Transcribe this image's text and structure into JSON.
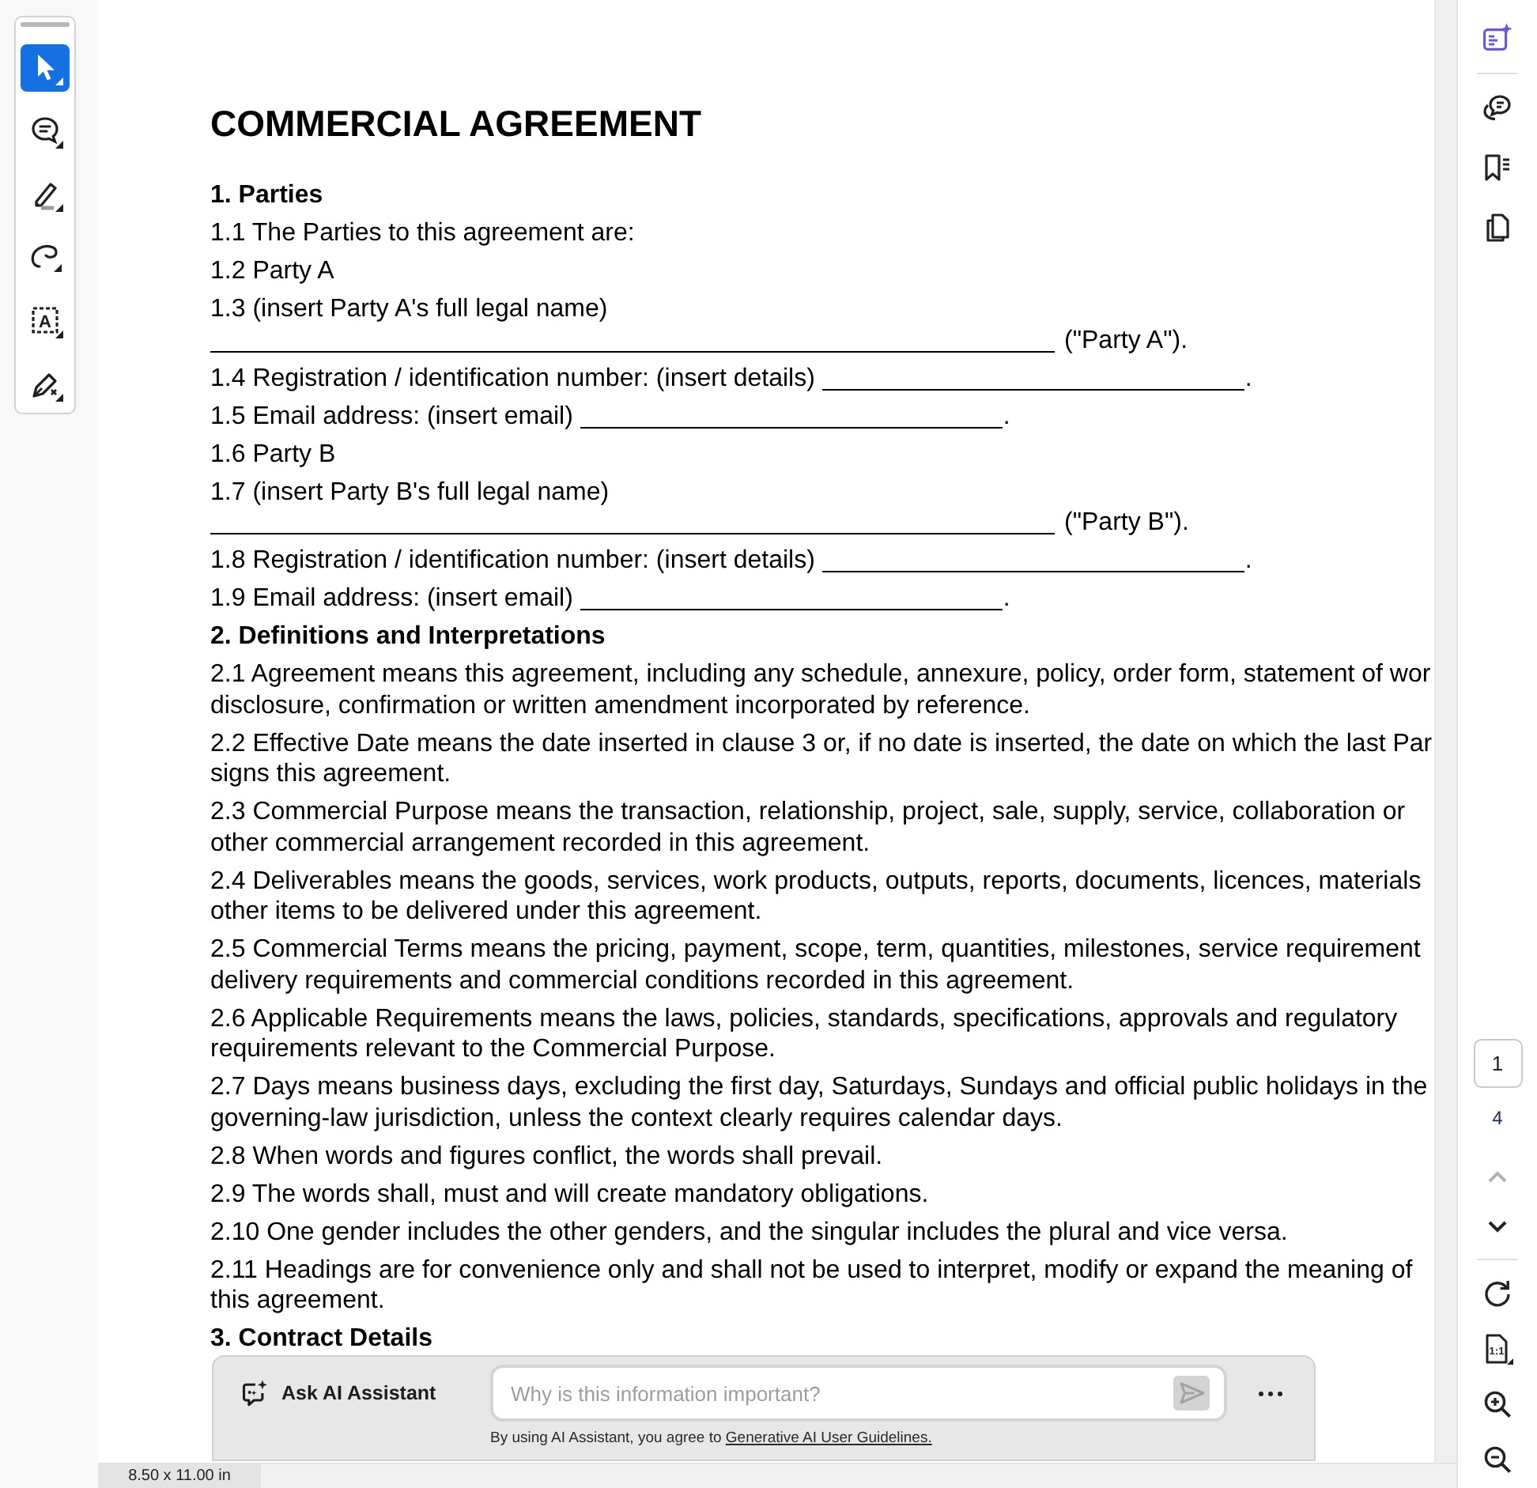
{
  "left_toolbar": {
    "tools": [
      {
        "kind": "select",
        "selected": true
      },
      {
        "kind": "comment",
        "selected": false
      },
      {
        "kind": "highlight",
        "selected": false
      },
      {
        "kind": "draw",
        "selected": false
      },
      {
        "kind": "text_select",
        "selected": false,
        "glyph": "A"
      },
      {
        "kind": "sign",
        "selected": false
      }
    ]
  },
  "document": {
    "title": "COMMERCIAL AGREEMENT",
    "sections": [
      {
        "heading": "1. Parties",
        "items": [
          {
            "kind": "paragraph",
            "lines": [
              "1.1 The Parties to this agreement are:"
            ]
          },
          {
            "kind": "paragraph",
            "lines": [
              "1.2 Party A"
            ]
          },
          {
            "kind": "name_field",
            "label": "1.3 (insert Party A's full legal name)",
            "suffix": "(\"Party A\")."
          },
          {
            "kind": "inline_field",
            "label": "1.4 Registration / identification number: (insert details)",
            "suffix": "."
          },
          {
            "kind": "inline_field",
            "label": "1.5 Email address: (insert email)",
            "suffix": "."
          },
          {
            "kind": "paragraph",
            "lines": [
              "1.6 Party B"
            ]
          },
          {
            "kind": "name_field",
            "label": "1.7 (insert Party B's full legal name)",
            "suffix": "(\"Party B\")."
          },
          {
            "kind": "inline_field",
            "label": "1.8 Registration / identification number: (insert details)",
            "suffix": "."
          },
          {
            "kind": "inline_field",
            "label": "1.9 Email address: (insert email)",
            "suffix": "."
          }
        ]
      },
      {
        "heading": "2. Definitions and Interpretations",
        "items": [
          {
            "kind": "paragraph",
            "lines": [
              "2.1 Agreement means this agreement, including any schedule, annexure, policy, order form, statement of wor",
              "disclosure, confirmation or written amendment incorporated by reference."
            ]
          },
          {
            "kind": "paragraph",
            "lines": [
              "2.2 Effective Date means the date inserted in clause 3 or, if no date is inserted, the date on which the last Par",
              "signs this agreement."
            ]
          },
          {
            "kind": "paragraph",
            "lines": [
              "2.3 Commercial Purpose means the transaction, relationship, project, sale, supply, service, collaboration or",
              "other commercial arrangement recorded in this agreement."
            ]
          },
          {
            "kind": "paragraph",
            "lines": [
              "2.4 Deliverables means the goods, services, work products, outputs, reports, documents, licences, materials",
              "other items to be delivered under this agreement."
            ]
          },
          {
            "kind": "paragraph",
            "lines": [
              "2.5 Commercial Terms means the pricing, payment, scope, term, quantities, milestones, service requirement",
              "delivery requirements and commercial conditions recorded in this agreement."
            ]
          },
          {
            "kind": "paragraph",
            "lines": [
              "2.6 Applicable Requirements means the laws, policies, standards, specifications, approvals and regulatory",
              "requirements relevant to the Commercial Purpose."
            ]
          },
          {
            "kind": "paragraph",
            "lines": [
              "2.7 Days means business days, excluding the first day, Saturdays, Sundays and official public holidays in the",
              "governing-law jurisdiction, unless the context clearly requires calendar days."
            ]
          },
          {
            "kind": "paragraph",
            "lines": [
              "2.8 When words and figures conflict, the words shall prevail."
            ]
          },
          {
            "kind": "paragraph",
            "lines": [
              "2.9 The words shall, must and will create mandatory obligations."
            ]
          },
          {
            "kind": "paragraph",
            "lines": [
              "2.10 One gender includes the other genders, and the singular includes the plural and vice versa."
            ]
          },
          {
            "kind": "paragraph",
            "lines": [
              "2.11 Headings are for convenience only and shall not be used to interpret, modify or expand the meaning of",
              "this agreement."
            ]
          }
        ]
      },
      {
        "heading": "3. Contract Details"
      }
    ]
  },
  "ai_assistant": {
    "label": "Ask AI Assistant",
    "input": {
      "placeholder": "Why is this information important?"
    },
    "send": {
      "disabled": true
    },
    "notice": {
      "text": "By using AI Assistant, you agree to",
      "link": "Generative AI User Guidelines."
    }
  },
  "right_rail": {
    "top_tools": [
      {
        "kind": "ai_assistant"
      },
      {
        "kind": "comments"
      },
      {
        "kind": "bookmarks"
      },
      {
        "kind": "pages"
      }
    ],
    "page_nav": {
      "current": "1",
      "total": "4",
      "previous": {
        "disabled": true
      },
      "next": {
        "disabled": false
      }
    },
    "view_tools": [
      {
        "kind": "rotate"
      },
      {
        "kind": "actual_size",
        "glyph": "1:1"
      },
      {
        "kind": "zoom_in"
      },
      {
        "kind": "zoom_out"
      }
    ]
  },
  "status_bar": {
    "page_size": "8.50 x 11.00 in"
  }
}
